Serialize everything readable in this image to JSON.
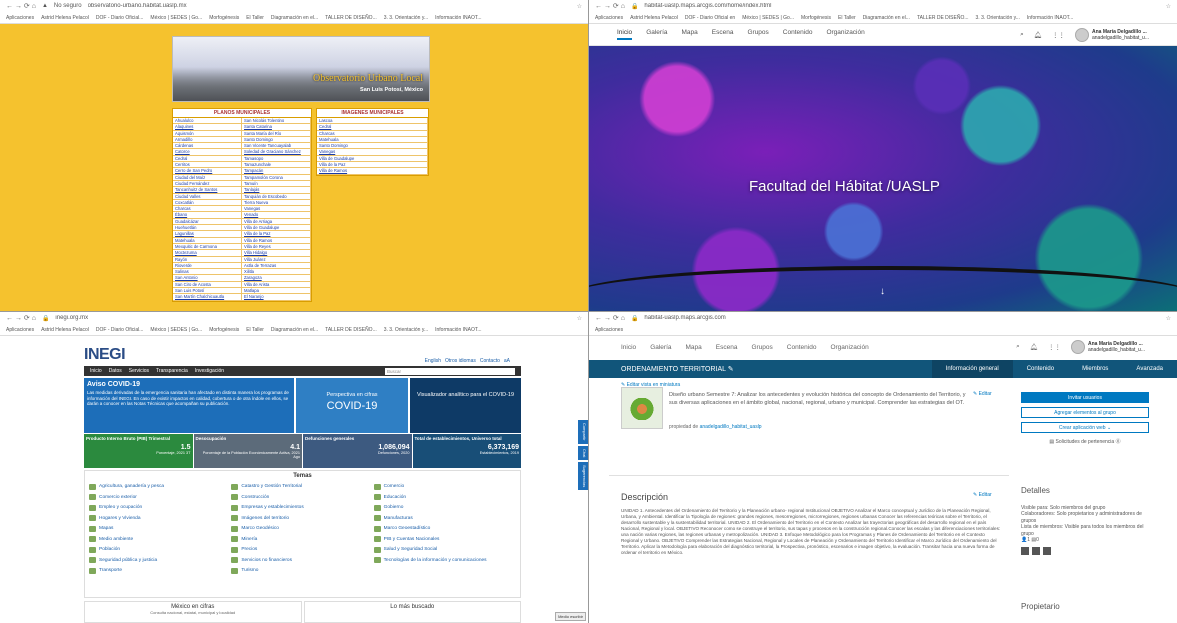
{
  "q1": {
    "url": "observatorio-urbano.habitat.uaslp.mx",
    "insecure_label": "No seguro",
    "bookmarks": [
      "Aplicaciones",
      "Astrid Helena Pelacol",
      "DOF - Diario Oficial...",
      "México | SEDES | Go...",
      "Morfogénesis",
      "El Taller",
      "Diagramación en el...",
      "TALLER DE DISEÑO...",
      "3. 3. Orientación y...",
      "Información INAOT..."
    ],
    "banner_title": "Observatorio Urbano Local",
    "banner_sub": "San Luis Potosí, México",
    "planos_title": "PLANOS MUNICIPALES",
    "imagenes_title": "IMAGENES MUNICIPALES",
    "planos": [
      "Ahualulco",
      "San Nicolás Tolentino",
      "Alaquines",
      "Santa Catarina",
      "Aquismón",
      "Santa María del Río",
      "Armadillo",
      "Santo Domingo",
      "Cárdenas",
      "San Vicente Tancuayalab",
      "Catorce",
      "Soledad de Graciano Sánchez",
      "Cedral",
      "Tamasopo",
      "Cerritos",
      "Tamazunchale",
      "Cerro de San Pedro",
      "Tampacán",
      "Ciudad del Maíz",
      "Tampamolón Corona",
      "Ciudad Fernández",
      "Tamuín",
      "Tancanhuitz de Santos",
      "Tanlajás",
      "Ciudad Valles",
      "Tanquián de Escobedo",
      "Coxcatlán",
      "Tierra Nueva",
      "Charcas",
      "Vanegas",
      "Ébano",
      "Venado",
      "Guadalcázar",
      "Villa de Arriaga",
      "Huehuetlán",
      "Villa de Guadalupe",
      "Lagunillas",
      "Villa de la Paz",
      "Matehuala",
      "Villa de Ramos",
      "Mexquitic de Carmona",
      "Villa de Reyes",
      "Moctezuma",
      "Villa Hidalgo",
      "Rayón",
      "Villa Juárez",
      "Rioverde",
      "Axtla de Terrazas",
      "Salinas",
      "Xilitla",
      "San Antonio",
      "Zaragoza",
      "San Ciro de Acosta",
      "Villa de Arista",
      "San Luis Potosí",
      "Matlapa",
      "San Martín Chalchicuautla",
      "El Naranjo"
    ],
    "imagenes": [
      "Lascoa",
      "Cedral",
      "Charcas",
      "Matehuala",
      "Santo Domingo",
      "Vanegas",
      "Villa de Guadalupe",
      "Villa de la Paz",
      "Villa de Ramos"
    ]
  },
  "q2": {
    "url": "habitat-uaslp.maps.arcgis.com/home/index.html",
    "bookmarks": [
      "Aplicaciones",
      "Astrid Helena Pelacol",
      "DOF - Diario Oficial en",
      "México | SEDES | Go...",
      "Morfogénesis",
      "El Taller",
      "Diagramación en el...",
      "TALLER DE DISEÑO...",
      "3. 3. Orientación y...",
      "Información INAOT..."
    ],
    "nav": [
      "Inicio",
      "Galería",
      "Mapa",
      "Escena",
      "Grupos",
      "Contenido",
      "Organización"
    ],
    "user_name": "Ana María Delgadillo ...",
    "user_handle": "anadelgadillo_habitat_u...",
    "hero_title": "Facultad del Hábitat /UASLP",
    "arrow": "↓"
  },
  "q3": {
    "url": "inegi.org.mx",
    "bookmarks": [
      "Aplicaciones",
      "Astrid Helena Pelacol",
      "DOF - Diario Oficial...",
      "México | SEDES | Go...",
      "Morfogénesis",
      "El Taller",
      "Diagramación en el...",
      "TALLER DE DISEÑO...",
      "3. 3. Orientación y...",
      "Información INAOT..."
    ],
    "logo": "INEGI",
    "toplinks": [
      "English",
      "Otros idiomas",
      "Contacto",
      "aA"
    ],
    "menu": [
      "Inicio",
      "Datos",
      "Servicios",
      "Transparencia",
      "Investigación"
    ],
    "search_placeholder": "Buscar",
    "covid_title": "Aviso COVID-19",
    "covid_text": "Las medidas derivadas de la emergencia sanitaria han afectado en distinta manera los programas de información del INEGI. En caso de existir impactos en calidad, cobertura o de otra índole en ellos, se darán a conocer en las Notas Técnicas que acompañan su publicación.",
    "persp_1": "Perspectiva en cifras",
    "persp_2": "COVID-19",
    "visual_1": "Visualizador analítico para el COVID-19",
    "stats": [
      {
        "t": "Producto Interno Bruto (PIB) Trimestral",
        "v": "1.5",
        "s": "Porcentaje, 2021 3T"
      },
      {
        "t": "Desocupación",
        "v": "4.1",
        "s": "Porcentaje de la Población Económicamente Activa, 2021 Ago"
      },
      {
        "t": "Defunciones generales",
        "v": "1,086,094",
        "s": "Defunciones, 2020"
      },
      {
        "t": "Total de establecimientos, Universo total",
        "v": "6,373,169",
        "s": "Establecimientos, 2019"
      }
    ],
    "temas_title": "Temas",
    "temas": [
      "Agricultura, ganadería y pesca",
      "Catastro y Gestión Territorial",
      "Comercio",
      "Comercio exterior",
      "Construcción",
      "Educación",
      "Empleo y ocupación",
      "Empresas y establecimientos",
      "Gobierno",
      "Hogares y Vivienda",
      "Imágenes del territorio",
      "Manufacturas",
      "Mapas",
      "Marco Geodésico",
      "Marco Geoestadístico",
      "Medio ambiente",
      "Minería",
      "PIB y Cuentas Nacionales",
      "Población",
      "Precios",
      "Salud y Seguridad Social",
      "Seguridad pública y justicia",
      "Servicios no financieros",
      "Tecnologías de la información y comunicaciones",
      "Transporte",
      "Turismo",
      ""
    ],
    "side_tabs": [
      "Compartir",
      "Chat",
      "Sugerencias"
    ],
    "bottom_1": "México en cifras",
    "bottom_1_sub": "Consulta nacional, estatal, municipal y localidad",
    "bottom_2": "Lo más buscado",
    "medio": "Medio escribir"
  },
  "q4": {
    "url": "habitat-uaslp.maps.arcgis.com",
    "bookmarks": [
      "Aplicaciones"
    ],
    "nav": [
      "Inicio",
      "Galería",
      "Mapa",
      "Escena",
      "Grupos",
      "Contenido",
      "Organización"
    ],
    "user_name": "Ana María Delgadillo ...",
    "user_handle": "anadelgadillo_habitat_u...",
    "group_title": "ORDENAMIENTO TERRITORIAL ✎",
    "tabs": [
      "Información general",
      "Contenido",
      "Miembros",
      "Avanzada"
    ],
    "edit_thumb": "✎ Editar vista en miniatura",
    "desc1": "Diseño urbano Semestre 7: Analizar los antecedentes y evolución histórica del concepto de Ordenamiento del Territorio, y sus diversas aplicaciones en el ámbito global, nacional, regional, urbano y municipal. Comprender las estrategias del OT.",
    "edit": "✎ Editar",
    "prop_label": "propiedad de",
    "prop_owner": "anadelgadillo_habitat_uaslp",
    "btn_invite": "Invitar usuarios",
    "btn_add": "Agregar elementos al grupo",
    "btn_create": "Crear aplicación web ⌄",
    "btn_requests": "▤ Solicitudes de pertenencia ⓪",
    "desc_title": "Descripción",
    "desc_body": "UNIDAD 1. Antecedentes del Ordenamiento del Territorio y la Planeación urbano- regional Institucional OBJETIVO Analizar el Marco conceptual y Jurídico de la Planeación Regional, Urbana, y Ambiental. Identificar la Tipología de regiones: grandes regiones, mesorregiones, microrregiones, regiones urbanas Conocer las referencias teóricas sobre el Territorio, el desarrollo sustentable y la sustentabilidad territorial. UNIDAD 2. El Ordenamiento del Territorio en el Contexto Analizar las trayectorias geográficas del desarrollo regional en el país Nacional, Regional y local. OBJETIVO Reconocer como se construye el territorio, sus tapas y procesos en la construcción regional.Conocer las escalas y las diferenciaciones territoriales: una nación varias regiones, las regiones urbanas y metropolización. UNIDAD 3. Enfoque Metodológico para los Programas y Planes de Ordenamiento del Territorio en el Contexto Regional y Urbano. OBJETIVO Comprender las Estrategias Nacional, Regional y Locales de Planeación y Ordenamiento del Territorio Identificar el Marco Jurídico del Ordenamiento del Territorio. Aplicar la Metodología para elaboración del diagnóstico territorial, la Prospectiva, pronóstico, escenarios e imagen objetivo, la evaluación. Transitar hacia una nueva forma de ordenar el territorio en México.",
    "details_title": "Detalles",
    "details_1": "Visible para: Solo miembros del grupo",
    "details_2": "Colaboradores: Solo propietarios y administradores de grupos",
    "details_3": "Lista de miembros: Visible para todos los miembros del grupo",
    "details_4": "👤1  ▤0",
    "owner_title": "Propietario"
  }
}
